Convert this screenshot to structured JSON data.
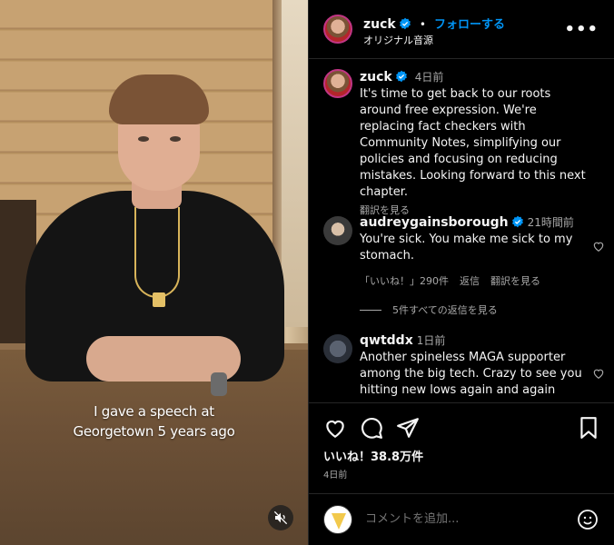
{
  "video": {
    "caption_line1": "I gave a speech at",
    "caption_line2": "Georgetown 5 years ago",
    "mute_icon": "mute-icon"
  },
  "header": {
    "username": "zuck",
    "separator": "•",
    "follow_label": "フォローする",
    "audio_label": "オリジナル音源",
    "more_label": "•••"
  },
  "caption_post": {
    "username": "zuck",
    "time": "4日前",
    "text": "It's time to get back to our roots around free expression. We're replacing fact checkers with Community Notes, simplifying our policies and focusing on reducing mistakes. Looking forward to this next chapter.",
    "translate": "翻訳を見る"
  },
  "comments": [
    {
      "username": "audreygainsborough",
      "verified": true,
      "time": "21時間前",
      "text": "You're sick. You make me sick to my stomach.",
      "likes": "「いいね！」290件",
      "reply": "返信",
      "translate": "翻訳を見る",
      "view_replies": "5件すべての返信を見る"
    },
    {
      "username": "qwtddx",
      "verified": false,
      "time": "1日前",
      "text": "Another spineless MAGA supporter among the big tech. Crazy to see you hitting new lows again and again"
    }
  ],
  "actions": {
    "likes": "いいね！38.8万件",
    "date": "4日前"
  },
  "add_comment": {
    "placeholder": "コメントを追加..."
  },
  "colors": {
    "accent": "#0095f6",
    "verified": "#0095f6",
    "muted": "#a8a8a8"
  }
}
